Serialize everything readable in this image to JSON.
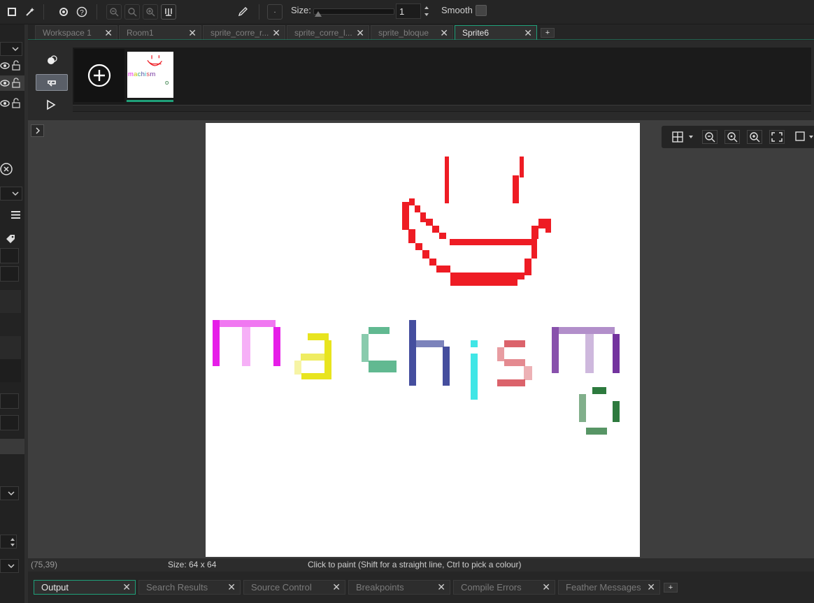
{
  "toolbar": {
    "size_label": "Size:",
    "size_value": "1",
    "smooth_label": "Smooth",
    "brush_preview": "·"
  },
  "tabs": [
    {
      "label": "Workspace 1",
      "active": false
    },
    {
      "label": "Room1",
      "active": false
    },
    {
      "label": "sprite_corre_r...",
      "active": false
    },
    {
      "label": "sprite_corre_l...",
      "active": false
    },
    {
      "label": "sprite_bloque",
      "active": false
    },
    {
      "label": "Sprite6",
      "active": true
    }
  ],
  "tab_add": "+",
  "frames": {
    "count": 1,
    "thumb_text": "machismo"
  },
  "canvas": {
    "sprite_width": 64,
    "sprite_height": 64,
    "text_letters": [
      "m",
      "a",
      "c",
      "h",
      "i",
      "s",
      "m",
      "o"
    ]
  },
  "status": {
    "cursor": "(75,39)",
    "size": "Size: 64 x 64",
    "hint": "Click to paint (Shift for a straight line, Ctrl to pick a colour)"
  },
  "output_tabs": [
    {
      "label": "Output",
      "active": true
    },
    {
      "label": "Search Results",
      "active": false
    },
    {
      "label": "Source Control",
      "active": false
    },
    {
      "label": "Breakpoints",
      "active": false
    },
    {
      "label": "Compile Errors",
      "active": false
    },
    {
      "label": "Feather Messages",
      "active": false
    }
  ],
  "output_add": "+",
  "colors": {
    "accent": "#1fa079",
    "smile_red": "#ee1c24",
    "magenta": "#e61ee8",
    "yellow": "#e8e41e",
    "teal": "#3aa876",
    "navy": "#454e9e",
    "cyan": "#40e6e6",
    "rose": "#d23c46",
    "purple": "#73339e",
    "green": "#2d7a3e"
  }
}
